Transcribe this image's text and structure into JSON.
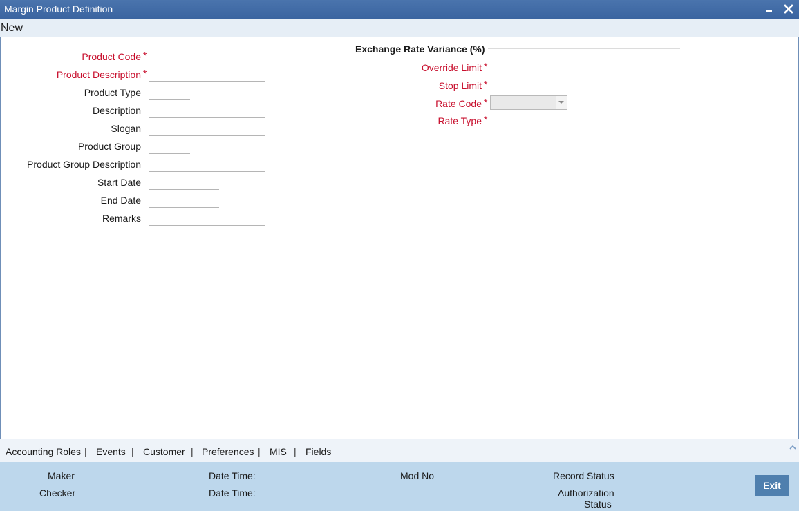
{
  "window": {
    "title": "Margin Product Definition"
  },
  "menu": {
    "new_label": "New"
  },
  "left_form": {
    "product_code": {
      "label": "Product Code",
      "value": ""
    },
    "product_description": {
      "label": "Product Description",
      "value": ""
    },
    "product_type": {
      "label": "Product Type",
      "value": ""
    },
    "description": {
      "label": "Description",
      "value": ""
    },
    "slogan": {
      "label": "Slogan",
      "value": ""
    },
    "product_group": {
      "label": "Product Group",
      "value": ""
    },
    "product_group_description": {
      "label": "Product Group Description",
      "value": ""
    },
    "start_date": {
      "label": "Start Date",
      "value": ""
    },
    "end_date": {
      "label": "End Date",
      "value": ""
    },
    "remarks": {
      "label": "Remarks",
      "value": ""
    }
  },
  "exchange_rate": {
    "section_title": "Exchange Rate Variance (%)",
    "override_limit": {
      "label": "Override Limit",
      "value": ""
    },
    "stop_limit": {
      "label": "Stop Limit",
      "value": ""
    },
    "rate_code": {
      "label": "Rate Code",
      "value": ""
    },
    "rate_type": {
      "label": "Rate Type",
      "value": ""
    }
  },
  "required_marker": "*",
  "tabs": [
    "Accounting Roles",
    "Events",
    "Customer",
    "Preferences",
    "MIS",
    "Fields"
  ],
  "tab_separator": "|",
  "footer": {
    "maker": "Maker",
    "checker": "Checker",
    "date_time_1": "Date Time:",
    "date_time_2": "Date Time:",
    "mod_no": "Mod No",
    "record_status": "Record Status",
    "authorization": "Authorization",
    "status": "Status",
    "exit_label": "Exit"
  },
  "colors": {
    "titlebar": "#3f6aa6",
    "required": "#c8102e",
    "footer": "#bdd7ec",
    "exit_button": "#4f7fae"
  }
}
